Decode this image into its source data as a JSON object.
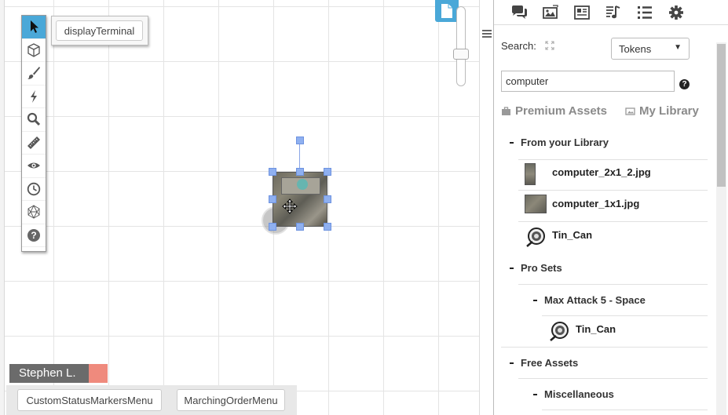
{
  "macros": {
    "top": "displayTerminal",
    "bottom": [
      "CustomStatusMarkersMenu",
      "MarchingOrderMenu"
    ]
  },
  "player": {
    "name": "Stephen L.",
    "color": "#ef8a7d"
  },
  "toolbar": {
    "tools": [
      "select-arrow-icon",
      "cube-icon",
      "brush-icon",
      "lightning-icon",
      "zoom-icon",
      "ruler-icon",
      "eye-icon",
      "clock-icon",
      "dice-icon",
      "help-icon"
    ],
    "active": "select-arrow-icon",
    "accent": "#4aa8d8"
  },
  "sidebar": {
    "tabs": [
      "chat-icon",
      "art-library-icon",
      "journal-icon",
      "jukebox-icon",
      "collections-icon",
      "settings-icon"
    ],
    "search_label": "Search:",
    "type_select": "Tokens",
    "search_value": "computer",
    "help": "?",
    "asset_tabs": [
      "Premium Assets",
      "My Library"
    ],
    "tree": {
      "library_header": "From your Library",
      "library_items": [
        "computer_2x1_2.jpg",
        "computer_1x1.jpg",
        "Tin_Can"
      ],
      "pro_sets_header": "Pro Sets",
      "pro_set": "Max Attack 5 - Space",
      "pro_set_items": [
        "Tin_Can"
      ],
      "free_header": "Free Assets",
      "free_sub": "Miscellaneous"
    }
  }
}
